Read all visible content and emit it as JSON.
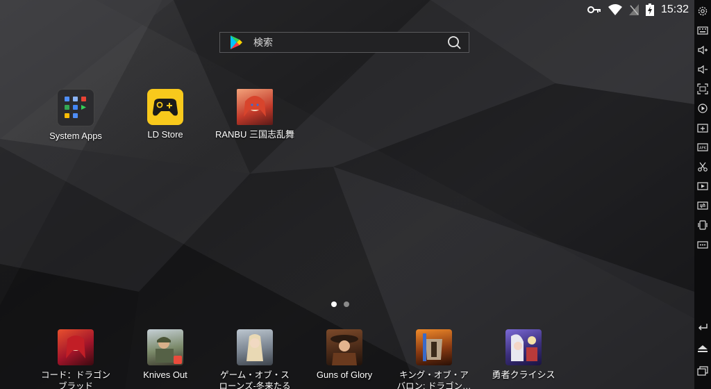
{
  "status": {
    "time": "15:32"
  },
  "search": {
    "placeholder": "検索"
  },
  "home_apps": [
    {
      "label": "System Apps"
    },
    {
      "label": "LD Store"
    },
    {
      "label": "RANBU 三国志乱舞"
    }
  ],
  "dock_apps": [
    {
      "label": "コード：ドラゴン\nブラッド"
    },
    {
      "label": "Knives Out"
    },
    {
      "label": "ゲーム・オブ・ス\nローンズ-冬来たる"
    },
    {
      "label": "Guns of Glory"
    },
    {
      "label": "キング・オブ・ア\nバロン: ドラゴン…"
    },
    {
      "label": "勇者クライシス"
    }
  ],
  "pages": {
    "count": 2,
    "active": 0
  },
  "colors": {
    "ld_store_yellow": "#f8c91c",
    "system_apps_bg": "#2b2b2e"
  },
  "toolbar_icons": [
    "settings-gear-icon",
    "keyboard-icon",
    "volume-up-icon",
    "volume-down-icon",
    "fullscreen-icon",
    "record-icon",
    "add-app-icon",
    "apk-icon",
    "scissors-icon",
    "video-icon",
    "sync-icon",
    "shake-icon",
    "more-icon",
    "back-icon",
    "home-icon",
    "recents-icon"
  ]
}
